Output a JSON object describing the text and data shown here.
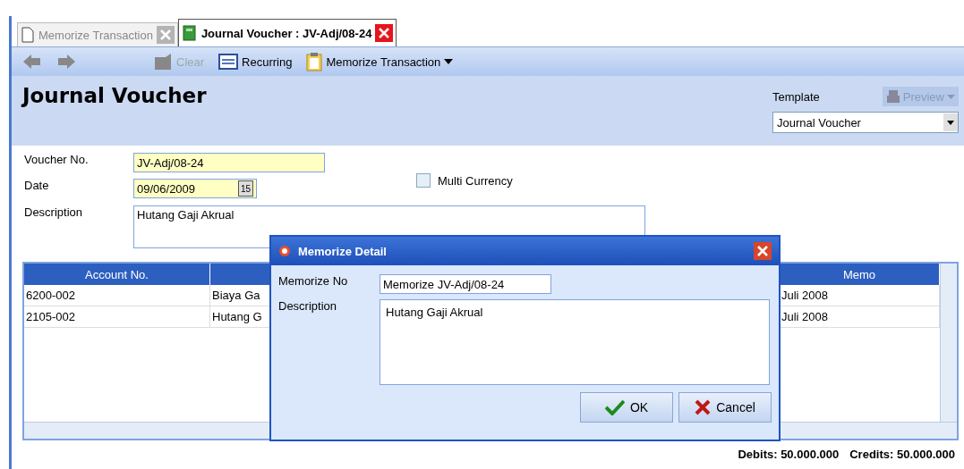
{
  "tabs": [
    {
      "label": "Memorize Transaction",
      "selected": false
    },
    {
      "label": "Journal Voucher : JV-Adj/08-24",
      "selected": true
    }
  ],
  "toolbar": [
    {
      "kind": "back",
      "disabled": true
    },
    {
      "kind": "forward",
      "disabled": true
    },
    {
      "kind": "clear",
      "label": "Clear",
      "disabled": true
    },
    {
      "kind": "recurring",
      "label": "Recurring",
      "disabled": false
    },
    {
      "kind": "memorize",
      "label": "Memorize Transaction",
      "disabled": false
    }
  ],
  "header": {
    "title": "Journal Voucher",
    "template_label": "Template",
    "preview": {
      "label": "Preview",
      "disabled": true
    },
    "template": "Journal Voucher"
  },
  "form": {
    "voucher_label": "Voucher No.",
    "voucher": "JV-Adj/08-24",
    "date_label": "Date",
    "date": "09/06/2009",
    "calendar": "15",
    "multi_currency": {
      "label": "Multi Currency",
      "checked": false
    },
    "description_label": "Description",
    "description": "Hutang Gaji Akrual"
  },
  "table": {
    "columns": [
      "Account No.",
      "Memo"
    ],
    "rows": [
      [
        "6200-002",
        "Biaya Ga",
        "Juli 2008"
      ],
      [
        "2105-002",
        "Hutang G",
        "Juli 2008"
      ]
    ]
  },
  "totals": {
    "debits": "Debits: 50.000.000",
    "credits": "Credits: 50.000.000"
  },
  "dialog": {
    "title": "Memorize Detail",
    "no_label": "Memorize No",
    "no": "Memorize JV-Adj/08-24",
    "description_label": "Description",
    "description": "Hutang Gaji Akrual",
    "buttons": [
      {
        "kind": "ok",
        "label": "OK"
      },
      {
        "kind": "cancel",
        "label": "Cancel"
      }
    ]
  }
}
